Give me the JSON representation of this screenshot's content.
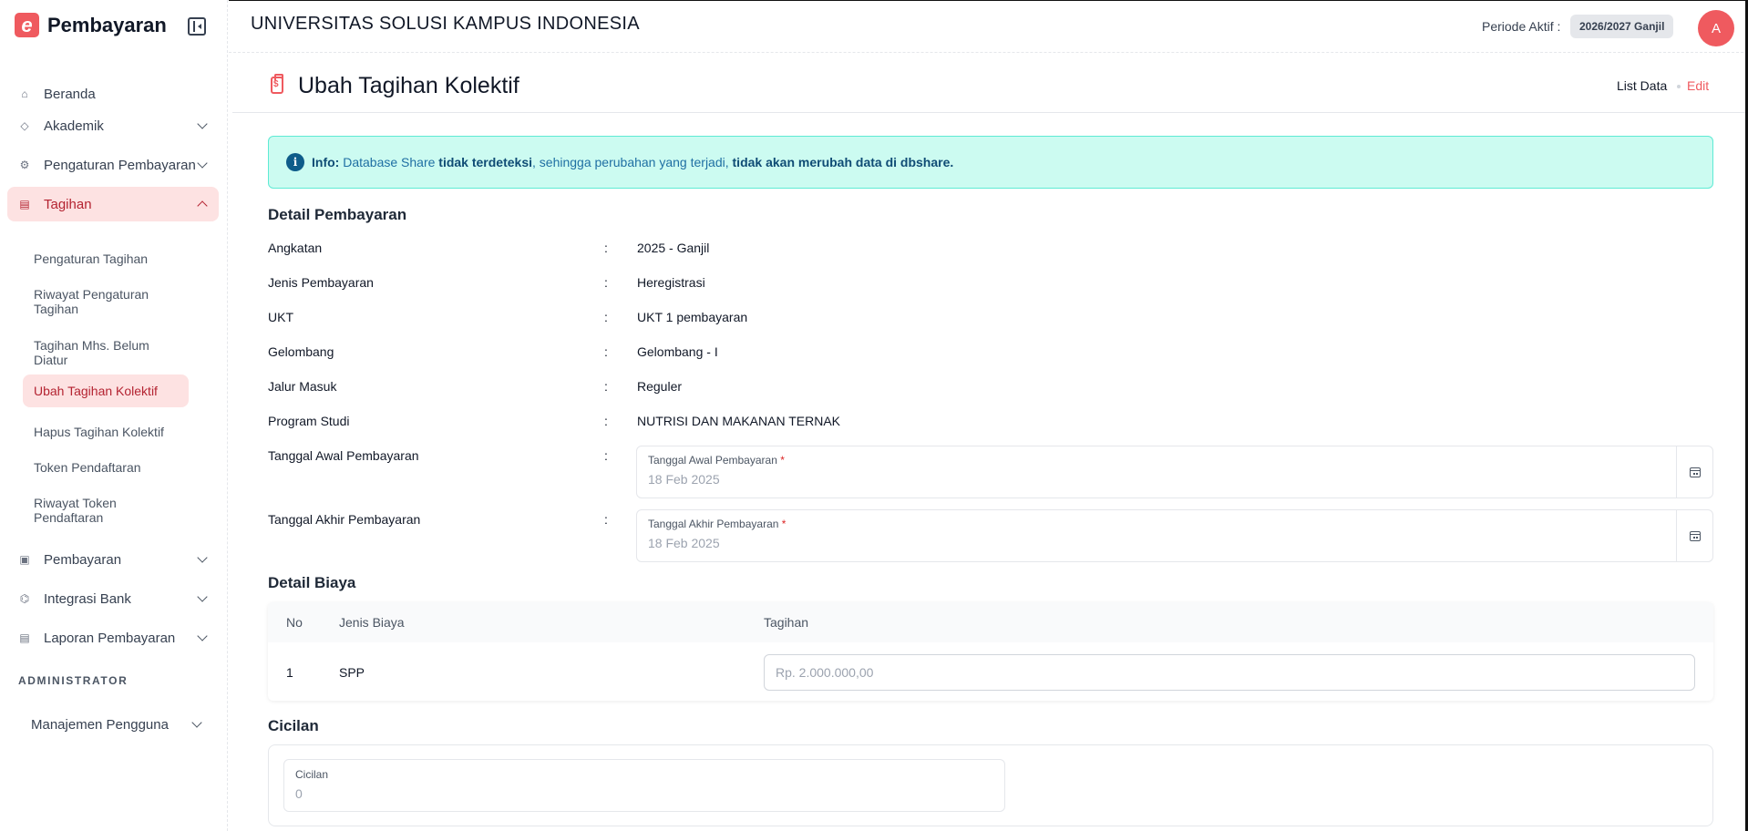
{
  "brand": {
    "logo_letter": "e",
    "name": "Pembayaran"
  },
  "sidebar": {
    "items": [
      {
        "label": "Beranda",
        "icon": "home-icon"
      },
      {
        "label": "Akademik",
        "icon": "graduation-cap-icon"
      },
      {
        "label": "Pengaturan Pembayaran",
        "icon": "gear-coin-icon"
      },
      {
        "label": "Tagihan",
        "icon": "clipboard-icon"
      },
      {
        "label": "Pembayaran",
        "icon": "wallet-icon"
      },
      {
        "label": "Integrasi Bank",
        "icon": "bank-icon"
      },
      {
        "label": "Laporan Pembayaran",
        "icon": "report-icon"
      }
    ],
    "subitems": [
      "Pengaturan Tagihan",
      "Riwayat Pengaturan Tagihan",
      "Tagihan Mhs. Belum Diatur",
      "Ubah Tagihan Kolektif",
      "Hapus Tagihan Kolektif",
      "Token Pendaftaran",
      "Riwayat Token Pendaftaran"
    ],
    "section_label": "ADMINISTRATOR",
    "manage_label": "Manajemen Pengguna"
  },
  "header": {
    "university": "UNIVERSITAS SOLUSI KAMPUS INDONESIA",
    "periode_label": "Periode Aktif :",
    "periode_value": "2026/2027 Ganjil",
    "avatar_initial": "A"
  },
  "page": {
    "title": "Ubah Tagihan Kolektif",
    "breadcrumb_list": "List Data",
    "breadcrumb_edit": "Edit"
  },
  "alert": {
    "info_symbol": "i",
    "prefix": "Info:",
    "part1": " Database Share ",
    "bold1": "tidak terdeteksi",
    "part2": ", sehingga perubahan yang terjadi, ",
    "bold2": "tidak akan merubah data di dbshare."
  },
  "detail": {
    "title": "Detail Pembayaran",
    "colon": ":",
    "rows": [
      {
        "label": "Angkatan",
        "value": "2025 - Ganjil"
      },
      {
        "label": "Jenis Pembayaran",
        "value": "Heregistrasi"
      },
      {
        "label": "UKT",
        "value": "UKT 1 pembayaran"
      },
      {
        "label": "Gelombang",
        "value": "Gelombang - I"
      },
      {
        "label": "Jalur Masuk",
        "value": "Reguler"
      },
      {
        "label": "Program Studi",
        "value": "NUTRISI DAN MAKANAN TERNAK"
      }
    ],
    "tanggal_awal": {
      "label": "Tanggal Awal Pembayaran",
      "field_label": "Tanggal Awal Pembayaran",
      "required": "*",
      "value": "18 Feb 2025"
    },
    "tanggal_akhir": {
      "label": "Tanggal Akhir Pembayaran",
      "field_label": "Tanggal Akhir Pembayaran",
      "required": "*",
      "value": "18 Feb 2025"
    }
  },
  "biaya": {
    "title": "Detail Biaya",
    "columns": [
      "No",
      "Jenis Biaya",
      "Tagihan"
    ],
    "rows": [
      {
        "no": "1",
        "jenis": "SPP",
        "tagihan_placeholder": "Rp. 2.000.000,00"
      }
    ]
  },
  "cicilan": {
    "title": "Cicilan",
    "field_label": "Cicilan",
    "value": "0"
  }
}
